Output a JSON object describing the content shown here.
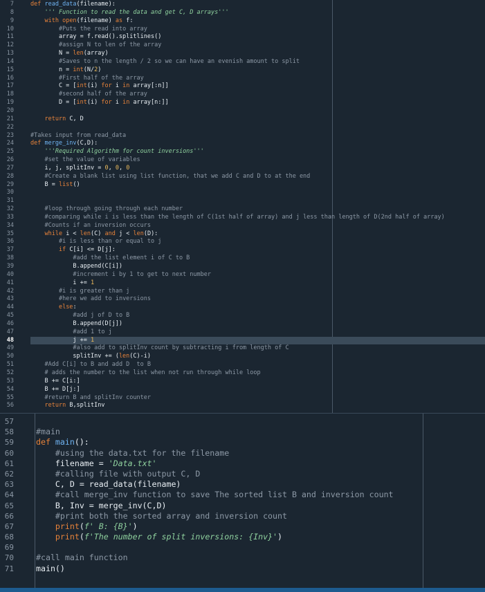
{
  "editor_top": {
    "cursor_line": 48,
    "lines": [
      {
        "n": "7",
        "t": [
          [
            "kw",
            "def "
          ],
          [
            "fn",
            "read_data"
          ],
          [
            "op",
            "(filename):"
          ]
        ]
      },
      {
        "n": "8",
        "t": [
          [
            "op",
            "    "
          ],
          [
            "ds",
            "''' Function to read the data and get C, D arrays'''"
          ]
        ]
      },
      {
        "n": "9",
        "t": [
          [
            "op",
            "    "
          ],
          [
            "kw",
            "with "
          ],
          [
            "bi",
            "open"
          ],
          [
            "op",
            "(filename) "
          ],
          [
            "kw",
            "as"
          ],
          [
            "op",
            " f:"
          ]
        ]
      },
      {
        "n": "10",
        "t": [
          [
            "op",
            "        "
          ],
          [
            "cm",
            "#Puts the read into array"
          ]
        ]
      },
      {
        "n": "11",
        "t": [
          [
            "op",
            "        array = f.read().splitlines()"
          ]
        ]
      },
      {
        "n": "12",
        "t": [
          [
            "op",
            "        "
          ],
          [
            "cm",
            "#assign N to len of the array"
          ]
        ]
      },
      {
        "n": "13",
        "t": [
          [
            "op",
            "        N = "
          ],
          [
            "bi",
            "len"
          ],
          [
            "op",
            "(array)"
          ]
        ]
      },
      {
        "n": "14",
        "t": [
          [
            "op",
            "        "
          ],
          [
            "cm",
            "#Saves to n the length / 2 so we can have an evenish amount to split"
          ]
        ]
      },
      {
        "n": "15",
        "t": [
          [
            "op",
            "        n = "
          ],
          [
            "bi",
            "int"
          ],
          [
            "op",
            "(N/"
          ],
          [
            "nu",
            "2"
          ],
          [
            "op",
            ")"
          ]
        ]
      },
      {
        "n": "16",
        "t": [
          [
            "op",
            "        "
          ],
          [
            "cm",
            "#First half of the array"
          ]
        ]
      },
      {
        "n": "17",
        "t": [
          [
            "op",
            "        C = ["
          ],
          [
            "bi",
            "int"
          ],
          [
            "op",
            "(i) "
          ],
          [
            "kw",
            "for"
          ],
          [
            "op",
            " i "
          ],
          [
            "kw",
            "in"
          ],
          [
            "op",
            " array[:n]]"
          ]
        ]
      },
      {
        "n": "18",
        "t": [
          [
            "op",
            "        "
          ],
          [
            "cm",
            "#second half of the array"
          ]
        ]
      },
      {
        "n": "19",
        "t": [
          [
            "op",
            "        D = ["
          ],
          [
            "bi",
            "int"
          ],
          [
            "op",
            "(i) "
          ],
          [
            "kw",
            "for"
          ],
          [
            "op",
            " i "
          ],
          [
            "kw",
            "in"
          ],
          [
            "op",
            " array[n:]]"
          ]
        ]
      },
      {
        "n": "20",
        "t": []
      },
      {
        "n": "21",
        "t": [
          [
            "op",
            "    "
          ],
          [
            "kw",
            "return"
          ],
          [
            "op",
            " C, D"
          ]
        ]
      },
      {
        "n": "22",
        "t": []
      },
      {
        "n": "23",
        "t": [
          [
            "cm",
            "#Takes input from read_data"
          ]
        ]
      },
      {
        "n": "24",
        "t": [
          [
            "kw",
            "def "
          ],
          [
            "fn",
            "merge_inv"
          ],
          [
            "op",
            "(C,D):"
          ]
        ]
      },
      {
        "n": "25",
        "t": [
          [
            "op",
            "    "
          ],
          [
            "ds",
            "'''Required Algorithm for count inversions'''"
          ]
        ]
      },
      {
        "n": "26",
        "t": [
          [
            "op",
            "    "
          ],
          [
            "cm",
            "#set the value of variables"
          ]
        ]
      },
      {
        "n": "27",
        "t": [
          [
            "op",
            "    i, j, splitInv = "
          ],
          [
            "nu",
            "0"
          ],
          [
            "op",
            ", "
          ],
          [
            "nu",
            "0"
          ],
          [
            "op",
            ", "
          ],
          [
            "nu",
            "0"
          ]
        ]
      },
      {
        "n": "28",
        "t": [
          [
            "op",
            "    "
          ],
          [
            "cm",
            "#Create a blank list using list function, that we add C and D to at the end"
          ]
        ]
      },
      {
        "n": "29",
        "t": [
          [
            "op",
            "    B = "
          ],
          [
            "bi",
            "list"
          ],
          [
            "op",
            "()"
          ]
        ]
      },
      {
        "n": "30",
        "t": []
      },
      {
        "n": "31",
        "t": []
      },
      {
        "n": "32",
        "t": [
          [
            "op",
            "    "
          ],
          [
            "cm",
            "#loop through going through each number"
          ]
        ]
      },
      {
        "n": "33",
        "t": [
          [
            "op",
            "    "
          ],
          [
            "cm",
            "#comparing while i is less than the length of C(1st half of array) and j less than length of D(2nd half of array)"
          ]
        ]
      },
      {
        "n": "34",
        "t": [
          [
            "op",
            "    "
          ],
          [
            "cm",
            "#Counts if an inversion occurs"
          ]
        ]
      },
      {
        "n": "35",
        "t": [
          [
            "op",
            "    "
          ],
          [
            "kw",
            "while"
          ],
          [
            "op",
            " i < "
          ],
          [
            "bi",
            "len"
          ],
          [
            "op",
            "(C) "
          ],
          [
            "kw",
            "and"
          ],
          [
            "op",
            " j < "
          ],
          [
            "bi",
            "len"
          ],
          [
            "op",
            "(D):"
          ]
        ]
      },
      {
        "n": "36",
        "t": [
          [
            "op",
            "        "
          ],
          [
            "cm",
            "#i is less than or equal to j"
          ]
        ]
      },
      {
        "n": "37",
        "t": [
          [
            "op",
            "        "
          ],
          [
            "kw",
            "if"
          ],
          [
            "op",
            " C[i] <= D[j]:"
          ]
        ]
      },
      {
        "n": "38",
        "t": [
          [
            "op",
            "            "
          ],
          [
            "cm",
            "#add the list element i of C to B"
          ]
        ]
      },
      {
        "n": "39",
        "t": [
          [
            "op",
            "            B.append(C[i])"
          ]
        ]
      },
      {
        "n": "40",
        "t": [
          [
            "op",
            "            "
          ],
          [
            "cm",
            "#increment i by 1 to get to next number"
          ]
        ]
      },
      {
        "n": "41",
        "t": [
          [
            "op",
            "            i += "
          ],
          [
            "nu",
            "1"
          ]
        ]
      },
      {
        "n": "42",
        "t": [
          [
            "op",
            "        "
          ],
          [
            "cm",
            "#i is greater than j"
          ]
        ]
      },
      {
        "n": "43",
        "t": [
          [
            "op",
            "        "
          ],
          [
            "cm",
            "#here we add to inversions"
          ]
        ]
      },
      {
        "n": "44",
        "t": [
          [
            "op",
            "        "
          ],
          [
            "kw",
            "else"
          ],
          [
            "op",
            ":"
          ]
        ]
      },
      {
        "n": "45",
        "t": [
          [
            "op",
            "            "
          ],
          [
            "cm",
            "#add j of D to B"
          ]
        ]
      },
      {
        "n": "46",
        "t": [
          [
            "op",
            "            B.append(D[j])"
          ]
        ]
      },
      {
        "n": "47",
        "t": [
          [
            "op",
            "            "
          ],
          [
            "cm",
            "#add 1 to j"
          ]
        ]
      },
      {
        "n": "48",
        "t": [
          [
            "op",
            "            j += "
          ],
          [
            "nu",
            "1"
          ]
        ]
      },
      {
        "n": "49",
        "t": [
          [
            "op",
            "            "
          ],
          [
            "cm",
            "#also add to splitInv count by subtracting i from length of C"
          ]
        ]
      },
      {
        "n": "50",
        "t": [
          [
            "op",
            "            splitInv += ("
          ],
          [
            "bi",
            "len"
          ],
          [
            "op",
            "(C)-i)"
          ]
        ]
      },
      {
        "n": "51",
        "t": [
          [
            "op",
            "    "
          ],
          [
            "cm",
            "#Add C[i] to B and add D  to B"
          ]
        ]
      },
      {
        "n": "52",
        "t": [
          [
            "op",
            "    "
          ],
          [
            "cm",
            "# adds the number to the list when not run through while loop"
          ]
        ]
      },
      {
        "n": "53",
        "t": [
          [
            "op",
            "    B += C[i:]"
          ]
        ]
      },
      {
        "n": "54",
        "t": [
          [
            "op",
            "    B += D[j:]"
          ]
        ]
      },
      {
        "n": "55",
        "t": [
          [
            "op",
            "    "
          ],
          [
            "cm",
            "#return B and splitInv counter"
          ]
        ]
      },
      {
        "n": "56",
        "t": [
          [
            "op",
            "    "
          ],
          [
            "kw",
            "return"
          ],
          [
            "op",
            " B,splitInv"
          ]
        ]
      }
    ]
  },
  "editor_bottom": {
    "lines": [
      {
        "n": "57",
        "t": []
      },
      {
        "n": "58",
        "t": [
          [
            "cm",
            "#main"
          ]
        ]
      },
      {
        "n": "59",
        "t": [
          [
            "kw",
            "def "
          ],
          [
            "fn",
            "main"
          ],
          [
            "op",
            "():"
          ]
        ]
      },
      {
        "n": "60",
        "t": [
          [
            "op",
            "    "
          ],
          [
            "cm",
            "#using the data.txt for the filename"
          ]
        ]
      },
      {
        "n": "61",
        "t": [
          [
            "op",
            "    filename = "
          ],
          [
            "st",
            "'Data.txt'"
          ]
        ]
      },
      {
        "n": "62",
        "t": [
          [
            "op",
            "    "
          ],
          [
            "cm",
            "#calling file with output C, D"
          ]
        ]
      },
      {
        "n": "63",
        "t": [
          [
            "op",
            "    C, D = read_data(filename)"
          ]
        ]
      },
      {
        "n": "64",
        "t": [
          [
            "op",
            "    "
          ],
          [
            "cm",
            "#call merge_inv function to save The sorted list B and inversion count"
          ]
        ]
      },
      {
        "n": "65",
        "t": [
          [
            "op",
            "    B, Inv = merge_inv(C,D)"
          ]
        ]
      },
      {
        "n": "66",
        "t": [
          [
            "op",
            "    "
          ],
          [
            "cm",
            "#print both the sorted array and inversion count"
          ]
        ]
      },
      {
        "n": "67",
        "t": [
          [
            "op",
            "    "
          ],
          [
            "bi",
            "print"
          ],
          [
            "op",
            "("
          ],
          [
            "st",
            "f' B: {B}'"
          ],
          [
            "op",
            ")"
          ]
        ]
      },
      {
        "n": "68",
        "t": [
          [
            "op",
            "    "
          ],
          [
            "bi",
            "print"
          ],
          [
            "op",
            "("
          ],
          [
            "st",
            "f'The number of split inversions: {Inv}'"
          ],
          [
            "op",
            ")"
          ]
        ]
      },
      {
        "n": "69",
        "t": []
      },
      {
        "n": "70",
        "t": [
          [
            "cm",
            "#call main function"
          ]
        ]
      },
      {
        "n": "71",
        "t": [
          [
            "op",
            "main()"
          ]
        ]
      }
    ]
  },
  "colors": {
    "background": "#1b2631",
    "keyword": "#e8833a",
    "function": "#6fb3f2",
    "comment": "#8d99a6",
    "string": "#8fd19e",
    "number": "#e9b95c",
    "current_line": "#3b4b5a"
  }
}
